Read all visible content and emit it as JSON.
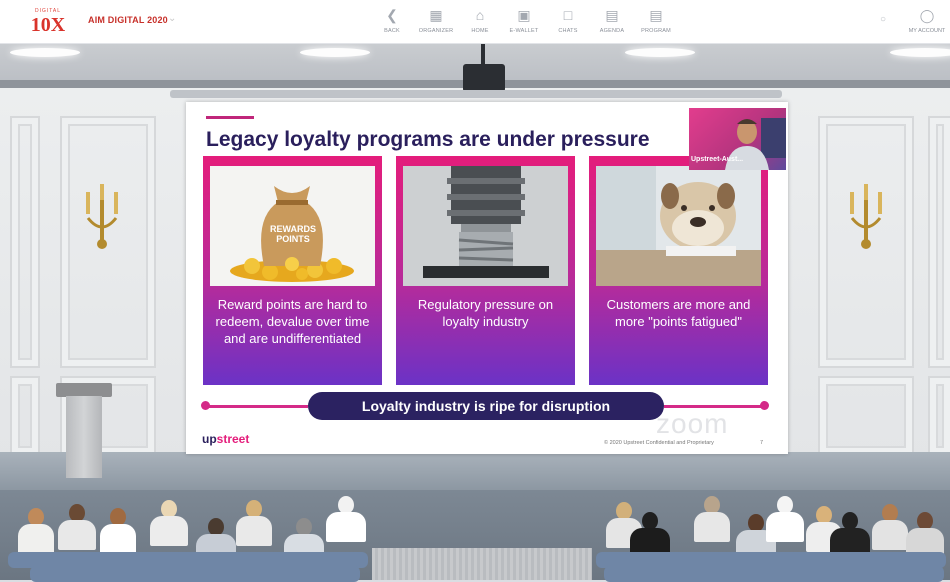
{
  "app": {
    "logo_small": "DIGITAL",
    "logo_big": "10X",
    "event_name": "AIM DIGITAL 2020"
  },
  "nav": {
    "items": [
      {
        "label": "BACK",
        "icon": "back-arrow-icon"
      },
      {
        "label": "ORGANIZER",
        "icon": "organizer-icon"
      },
      {
        "label": "HOME",
        "icon": "home-icon"
      },
      {
        "label": "E-WALLET",
        "icon": "wallet-icon"
      },
      {
        "label": "CHATS",
        "icon": "chat-icon"
      },
      {
        "label": "AGENDA",
        "icon": "agenda-icon"
      },
      {
        "label": "PROGRAM",
        "icon": "program-icon"
      }
    ],
    "account_label": "MY ACCOUNT"
  },
  "slide": {
    "title": "Legacy loyalty programs are under pressure",
    "cards": [
      {
        "text": "Reward points are hard to redeem, devalue over time and are undifferentiated",
        "image": "reward-points-bag"
      },
      {
        "text": "Regulatory pressure on loyalty industry",
        "image": "hydraulic-press"
      },
      {
        "text": "Customers are more and more \"points fatigued\"",
        "image": "tired-bulldog"
      }
    ],
    "reward_bag_text": "REWARDS POINTS",
    "banner": "Loyalty industry is ripe for disruption",
    "brand_up": "up",
    "brand_street": "street",
    "watermark": "zoom",
    "footer": "© 2020 Upstreet Confidential and Proprietary",
    "page": "7",
    "speaker_name": "Upstreet-Aust..."
  },
  "colors": {
    "brand_red": "#d9332b",
    "card_top": "#e41d7b",
    "card_bottom": "#6b32c6",
    "banner": "#2b2261",
    "title": "#2a1f5c"
  }
}
